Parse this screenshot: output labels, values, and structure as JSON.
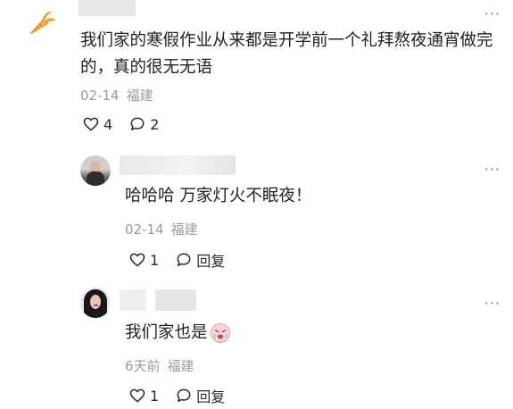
{
  "comments": [
    {
      "text": "我们家的寒假作业从来都是开学前一个礼拜熬夜通宵做完的，真的很无无语",
      "date": "02-14",
      "location": "福建",
      "likes": "4",
      "replies": "2",
      "more": "···",
      "avatar_icon": "carrot-icon"
    },
    {
      "text": "哈哈哈 万家灯火不眠夜！",
      "date": "02-14",
      "location": "福建",
      "likes": "1",
      "reply_label": "回复",
      "more": "···"
    },
    {
      "text": "我们家也是",
      "emoji": "crying-face-icon",
      "date": "6天前",
      "location": "福建",
      "likes": "1",
      "reply_label": "回复",
      "more": "···"
    }
  ]
}
